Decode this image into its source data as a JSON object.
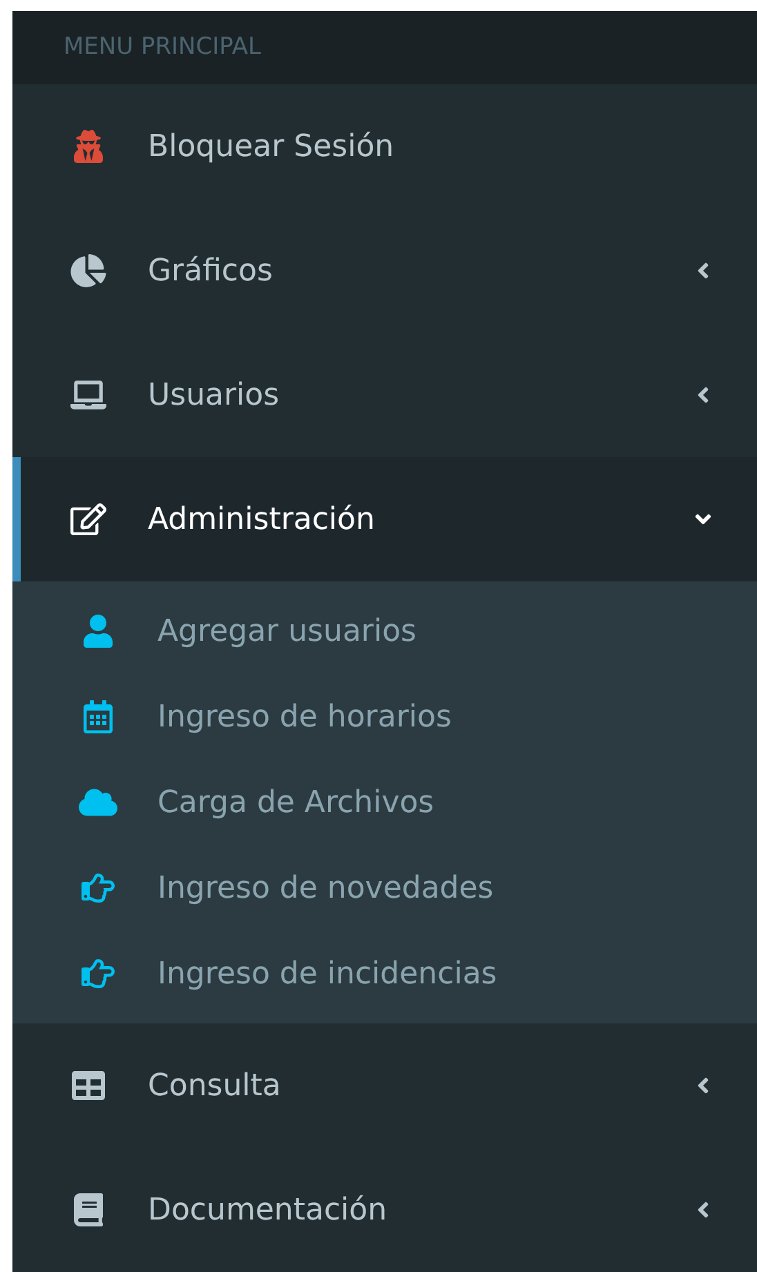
{
  "header": "MENU PRINCIPAL",
  "items": [
    {
      "label": "Bloquear Sesión",
      "selected": false
    },
    {
      "label": "Gráficos",
      "selected": false,
      "expanded": false
    },
    {
      "label": "Usuarios",
      "selected": false,
      "expanded": false
    },
    {
      "label": "Administración",
      "selected": true,
      "expanded": true,
      "children": [
        {
          "label": "Agregar usuarios"
        },
        {
          "label": "Ingreso de horarios"
        },
        {
          "label": "Carga de Archivos"
        },
        {
          "label": "Ingreso de novedades"
        },
        {
          "label": "Ingreso de incidencias"
        }
      ]
    },
    {
      "label": "Consulta",
      "selected": false,
      "expanded": false
    },
    {
      "label": "Documentación",
      "selected": false,
      "expanded": false
    }
  ]
}
